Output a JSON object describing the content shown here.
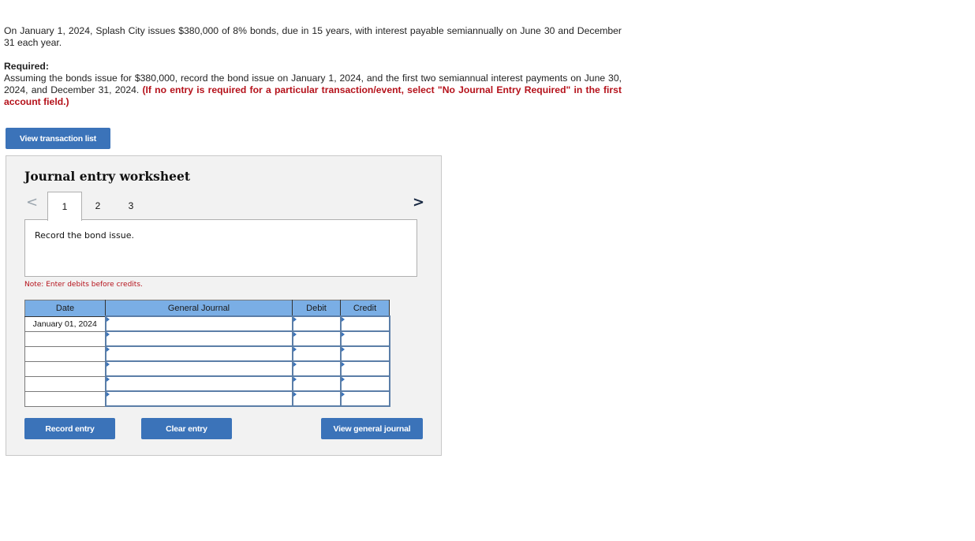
{
  "problem": {
    "text": "On January 1, 2024, Splash City issues $380,000 of 8% bonds, due in 15 years, with interest payable semiannually on June 30 and December 31 each year."
  },
  "required": {
    "title": "Required:",
    "text": "Assuming the bonds issue for $380,000, record the bond issue on January 1, 2024, and the first two semiannual interest payments on June 30, 2024, and December 31, 2024.",
    "emphasis": "(If no entry is required for a particular transaction/event, select \"No Journal Entry Required\" in the first account field.)"
  },
  "buttons": {
    "view_transaction_list": "View transaction list",
    "record_entry": "Record entry",
    "clear_entry": "Clear entry",
    "view_general_journal": "View general journal"
  },
  "worksheet": {
    "title": "Journal entry worksheet",
    "nav_prev": "<",
    "nav_next": ">",
    "tabs": [
      {
        "label": "1",
        "active": true
      },
      {
        "label": "2",
        "active": false
      },
      {
        "label": "3",
        "active": false
      }
    ],
    "instruction": "Record the bond issue.",
    "note": "Note: Enter debits before credits."
  },
  "journal": {
    "headers": {
      "date": "Date",
      "account": "General Journal",
      "debit": "Debit",
      "credit": "Credit"
    },
    "rows": [
      {
        "date": "January 01, 2024",
        "account": "",
        "debit": "",
        "credit": ""
      },
      {
        "date": "",
        "account": "",
        "debit": "",
        "credit": ""
      },
      {
        "date": "",
        "account": "",
        "debit": "",
        "credit": ""
      },
      {
        "date": "",
        "account": "",
        "debit": "",
        "credit": ""
      },
      {
        "date": "",
        "account": "",
        "debit": "",
        "credit": ""
      },
      {
        "date": "",
        "account": "",
        "debit": "",
        "credit": ""
      }
    ]
  },
  "colors": {
    "button_blue": "#3b73b9",
    "header_blue": "#7aaee5",
    "emphasis_red": "#b5121b",
    "panel_bg": "#f2f2f2"
  }
}
